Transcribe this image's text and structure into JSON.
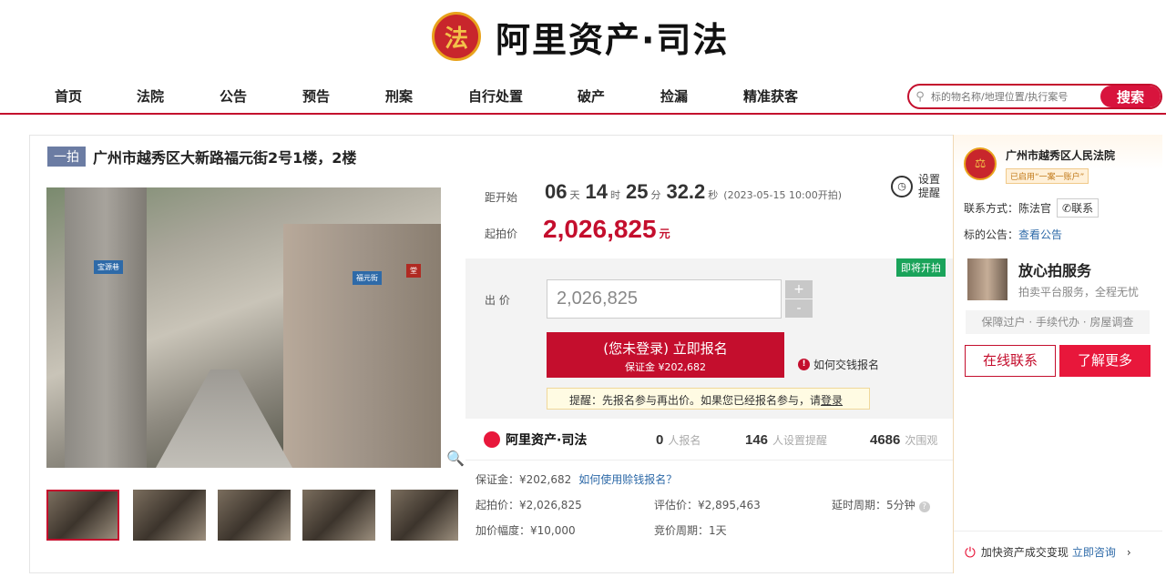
{
  "header": {
    "logo_emblem": "法",
    "logo_text": "阿里资产·司法"
  },
  "nav": {
    "items": [
      "首页",
      "法院",
      "公告",
      "预告",
      "刑案",
      "自行处置",
      "破产",
      "捡漏",
      "精准获客"
    ]
  },
  "search": {
    "placeholder": "标的物名称/地理位置/执行案号",
    "button": "搜索"
  },
  "auction": {
    "tag": "一拍",
    "title": "广州市越秀区大新路福元街2号1楼，2楼",
    "image_signs": [
      "宝源巷",
      "福元街",
      "堂"
    ],
    "countdown_label": "距开始",
    "days": "06",
    "days_unit": "天",
    "hours": "14",
    "hours_unit": "时",
    "minutes": "25",
    "minutes_unit": "分",
    "seconds": "32.2",
    "seconds_unit": "秒",
    "start_note": "(2023-05-15 10:00开拍)",
    "reminder": "设置提醒",
    "start_price_label": "起拍价",
    "start_price": "2,026,825",
    "start_price_unit": "元",
    "soon_badge": "即将开拍",
    "bid_label": "出 价",
    "bid_value": "2,026,825",
    "plus": "+",
    "minus": "-",
    "register_main": "(您未登录) 立即报名",
    "register_sub": "保证金 ¥202,682",
    "how_pay": "如何交钱报名",
    "tip_text": "提醒：先报名参与再出价。如果您已经报名参与，请",
    "tip_link": "登录"
  },
  "stats": {
    "brand": "阿里资产·司法",
    "registered_num": "0",
    "registered_label": "人报名",
    "reminder_num": "146",
    "reminder_label": "人设置提醒",
    "views_num": "4686",
    "views_label": "次围观"
  },
  "details": {
    "deposit": "保证金：¥202,682",
    "deposit_link": "如何使用赊钱报名？",
    "start_price": "起拍价：¥2,026,825",
    "assess_price": "评估价：¥2,895,463",
    "delay": "延时周期：5分钟",
    "increment": "加价幅度：¥10,000",
    "cycle": "竞价周期：1天"
  },
  "sidebar": {
    "court_name": "广州市越秀区人民法院",
    "court_badge": "已启用“一案一账户”",
    "contact_text": "联系方式：陈法官",
    "contact_btn": "联系",
    "notice_label": "标的公告：",
    "notice_link": "查看公告",
    "svc_title": "放心拍服务",
    "svc_sub": "拍卖平台服务，全程无忧",
    "svc_bar": "保障过户 · 手续代办 · 房屋调查",
    "btn_online": "在线联系",
    "btn_more": "了解更多",
    "speed_text": "加快资产成交变现",
    "speed_link": "立即咨询"
  }
}
